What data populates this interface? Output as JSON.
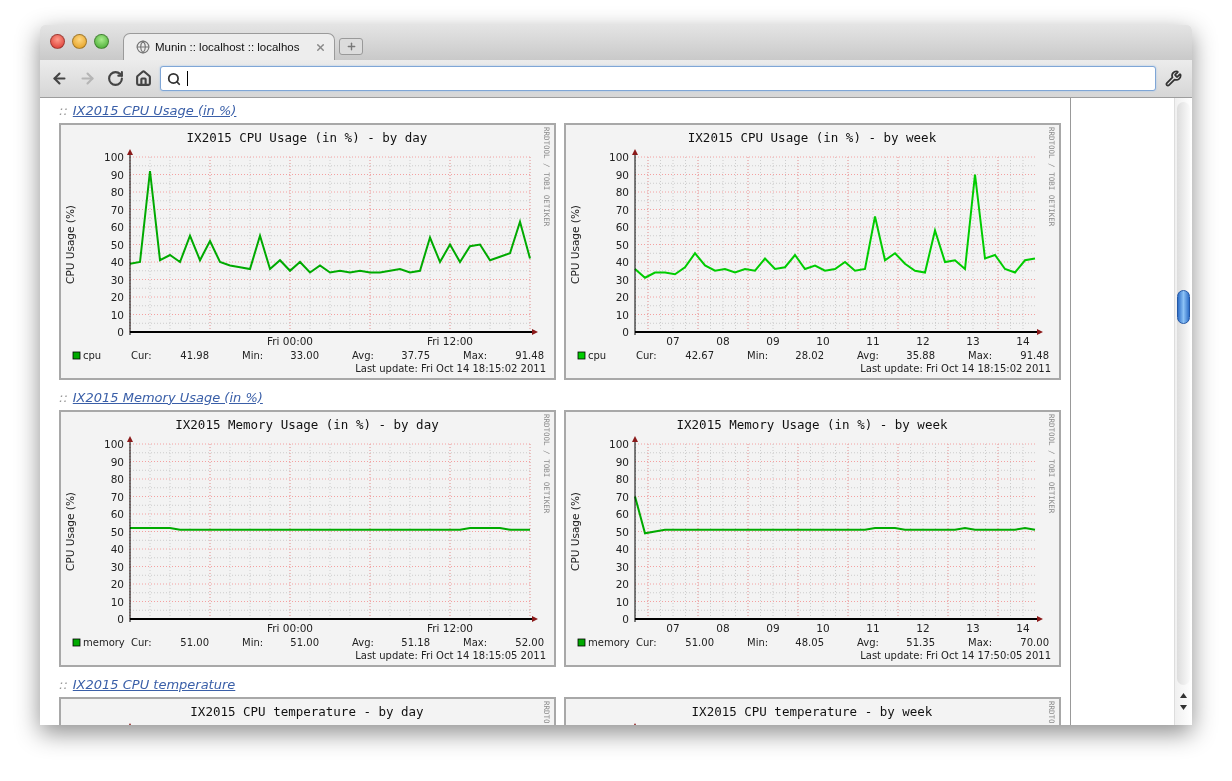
{
  "browser": {
    "tab": {
      "title": "Munin :: localhost :: localhos",
      "selected": true
    },
    "nav_buttons": [
      {
        "kind": "back",
        "disabled": false
      },
      {
        "kind": "forward",
        "disabled": true
      },
      {
        "kind": "reload",
        "disabled": false
      },
      {
        "kind": "home",
        "disabled": false
      }
    ]
  },
  "sections": [
    {
      "prefix": "::",
      "heading": "IX2015 CPU Usage (in %)",
      "graphs": [
        {
          "side_text": "RRDTOOL / TOBI OETIKER",
          "stats": [
            {
              "label": "Cur:",
              "value": "41.98"
            },
            {
              "label": "Min:",
              "value": "33.00"
            },
            {
              "label": "Avg:",
              "value": "37.75"
            },
            {
              "label": "Max:",
              "value": "91.48"
            }
          ],
          "last_update": "Last update: Fri Oct 14 18:15:02 2011",
          "chart_data": {
            "type": "line",
            "title": "IX2015 CPU Usage (in %) - by day",
            "ylabel": "CPU Usage (%)",
            "grid": true,
            "ylim": [
              0,
              100
            ],
            "yticks": [
              0,
              10,
              20,
              30,
              40,
              50,
              60,
              70,
              80,
              90,
              100
            ],
            "categories": [
              null,
              null,
              null,
              null,
              null,
              null,
              null,
              null,
              null,
              null,
              null,
              null,
              null,
              null,
              null,
              null,
              "Fri 00:00",
              null,
              null,
              null,
              null,
              null,
              null,
              null,
              null,
              null,
              null,
              null,
              null,
              null,
              null,
              null,
              "Fri 12:00",
              null,
              null,
              null,
              null,
              null,
              null,
              null,
              null
            ],
            "series": [
              {
                "name": "cpu",
                "color": "#00aa00",
                "values": [
                  39,
                  40,
                  92,
                  41,
                  44,
                  40,
                  55,
                  41,
                  52,
                  40,
                  38,
                  37,
                  36,
                  55,
                  36,
                  41,
                  35,
                  40,
                  34,
                  38,
                  34,
                  35,
                  34,
                  35,
                  34,
                  34,
                  35,
                  36,
                  34,
                  35,
                  54,
                  40,
                  50,
                  40,
                  49,
                  50,
                  41,
                  43,
                  45,
                  63,
                  42
                ]
              }
            ]
          }
        },
        {
          "side_text": "RRDTOOL / TOBI OETIKER",
          "stats": [
            {
              "label": "Cur:",
              "value": "42.67"
            },
            {
              "label": "Min:",
              "value": "28.02"
            },
            {
              "label": "Avg:",
              "value": "35.88"
            },
            {
              "label": "Max:",
              "value": "91.48"
            }
          ],
          "last_update": "Last update: Fri Oct 14 18:15:02 2011",
          "chart_data": {
            "type": "line",
            "title": "IX2015 CPU Usage (in %) - by week",
            "ylabel": "CPU Usage (%)",
            "grid": true,
            "xlim": [
              6.24,
              14.24
            ],
            "ylim": [
              0,
              100
            ],
            "yticks": [
              0,
              10,
              20,
              30,
              40,
              50,
              60,
              70,
              80,
              90,
              100
            ],
            "xticks": [
              {
                "value": 7,
                "label": "07"
              },
              {
                "value": 8,
                "label": "08"
              },
              {
                "value": 9,
                "label": "09"
              },
              {
                "value": 10,
                "label": "10"
              },
              {
                "value": 11,
                "label": "11"
              },
              {
                "value": 12,
                "label": "12"
              },
              {
                "value": 13,
                "label": "13"
              },
              {
                "value": 14,
                "label": "14"
              }
            ],
            "x": [
              6.24,
              6.44,
              6.64,
              6.84,
              7.04,
              7.24,
              7.44,
              7.64,
              7.84,
              8.04,
              8.24,
              8.44,
              8.64,
              8.84,
              9.04,
              9.24,
              9.44,
              9.64,
              9.84,
              10.04,
              10.24,
              10.44,
              10.64,
              10.84,
              11.04,
              11.24,
              11.44,
              11.64,
              11.84,
              12.04,
              12.24,
              12.44,
              12.64,
              12.84,
              13.04,
              13.24,
              13.44,
              13.64,
              13.84,
              14.04,
              14.24
            ],
            "series": [
              {
                "name": "cpu",
                "color": "#00cc00",
                "values": [
                  36,
                  31,
                  34,
                  34,
                  33,
                  37,
                  45,
                  38,
                  35,
                  36,
                  34,
                  36,
                  35,
                  42,
                  36,
                  37,
                  44,
                  36,
                  38,
                  35,
                  36,
                  40,
                  35,
                  36,
                  66,
                  41,
                  45,
                  39,
                  35,
                  34,
                  58,
                  40,
                  41,
                  36,
                  90,
                  42,
                  44,
                  36,
                  34,
                  41,
                  42
                ]
              }
            ]
          }
        }
      ]
    },
    {
      "prefix": "::",
      "heading": "IX2015 Memory Usage (in %)",
      "graphs": [
        {
          "side_text": "RRDTOOL / TOBI OETIKER",
          "stats": [
            {
              "label": "Cur:",
              "value": "51.00"
            },
            {
              "label": "Min:",
              "value": "51.00"
            },
            {
              "label": "Avg:",
              "value": "51.18"
            },
            {
              "label": "Max:",
              "value": "52.00"
            }
          ],
          "last_update": "Last update: Fri Oct 14 18:15:05 2011",
          "chart_data": {
            "type": "line",
            "title": "IX2015 Memory Usage (in %) - by day",
            "ylabel": "CPU Usage (%)",
            "grid": true,
            "ylim": [
              0,
              100
            ],
            "yticks": [
              0,
              10,
              20,
              30,
              40,
              50,
              60,
              70,
              80,
              90,
              100
            ],
            "categories": [
              null,
              null,
              null,
              null,
              null,
              null,
              null,
              null,
              null,
              null,
              null,
              null,
              null,
              null,
              null,
              null,
              "Fri 00:00",
              null,
              null,
              null,
              null,
              null,
              null,
              null,
              null,
              null,
              null,
              null,
              null,
              null,
              null,
              null,
              "Fri 12:00",
              null,
              null,
              null,
              null,
              null,
              null,
              null,
              null
            ],
            "series": [
              {
                "name": "memory",
                "color": "#00aa00",
                "values": [
                  52,
                  52,
                  52,
                  52,
                  52,
                  51,
                  51,
                  51,
                  51,
                  51,
                  51,
                  51,
                  51,
                  51,
                  51,
                  51,
                  51,
                  51,
                  51,
                  51,
                  51,
                  51,
                  51,
                  51,
                  51,
                  51,
                  51,
                  51,
                  51,
                  51,
                  51,
                  51,
                  51,
                  51,
                  52,
                  52,
                  52,
                  52,
                  51,
                  51,
                  51
                ]
              }
            ]
          }
        },
        {
          "side_text": "RRDTOOL / TOBI OETIKER",
          "stats": [
            {
              "label": "Cur:",
              "value": "51.00"
            },
            {
              "label": "Min:",
              "value": "48.05"
            },
            {
              "label": "Avg:",
              "value": "51.35"
            },
            {
              "label": "Max:",
              "value": "70.00"
            }
          ],
          "last_update": "Last update: Fri Oct 14 17:50:05 2011",
          "chart_data": {
            "type": "line",
            "title": "IX2015 Memory Usage (in %) - by week",
            "ylabel": "CPU Usage (%)",
            "grid": true,
            "xlim": [
              6.24,
              14.24
            ],
            "ylim": [
              0,
              100
            ],
            "yticks": [
              0,
              10,
              20,
              30,
              40,
              50,
              60,
              70,
              80,
              90,
              100
            ],
            "xticks": [
              {
                "value": 7,
                "label": "07"
              },
              {
                "value": 8,
                "label": "08"
              },
              {
                "value": 9,
                "label": "09"
              },
              {
                "value": 10,
                "label": "10"
              },
              {
                "value": 11,
                "label": "11"
              },
              {
                "value": 12,
                "label": "12"
              },
              {
                "value": 13,
                "label": "13"
              },
              {
                "value": 14,
                "label": "14"
              }
            ],
            "x": [
              6.24,
              6.44,
              6.64,
              6.84,
              7.04,
              7.24,
              7.44,
              7.64,
              7.84,
              8.04,
              8.24,
              8.44,
              8.64,
              8.84,
              9.04,
              9.24,
              9.44,
              9.64,
              9.84,
              10.04,
              10.24,
              10.44,
              10.64,
              10.84,
              11.04,
              11.24,
              11.44,
              11.64,
              11.84,
              12.04,
              12.24,
              12.44,
              12.64,
              12.84,
              13.04,
              13.24,
              13.44,
              13.64,
              13.84,
              14.04,
              14.24
            ],
            "series": [
              {
                "name": "memory",
                "color": "#00aa00",
                "values": [
                  70,
                  49,
                  50,
                  51,
                  51,
                  51,
                  51,
                  51,
                  51,
                  51,
                  51,
                  51,
                  51,
                  51,
                  51,
                  51,
                  51,
                  51,
                  51,
                  51,
                  51,
                  51,
                  51,
                  51,
                  52,
                  52,
                  52,
                  51,
                  51,
                  51,
                  51,
                  51,
                  51,
                  52,
                  51,
                  51,
                  51,
                  51,
                  51,
                  52,
                  51
                ]
              }
            ]
          }
        }
      ]
    },
    {
      "prefix": "::",
      "heading": "IX2015 CPU temperature",
      "graphs": [
        {
          "title": "IX2015 CPU temperature - by day",
          "side_text": "RRDTO"
        },
        {
          "title": "IX2015 CPU temperature - by week",
          "side_text": "RRDTO"
        }
      ]
    }
  ]
}
